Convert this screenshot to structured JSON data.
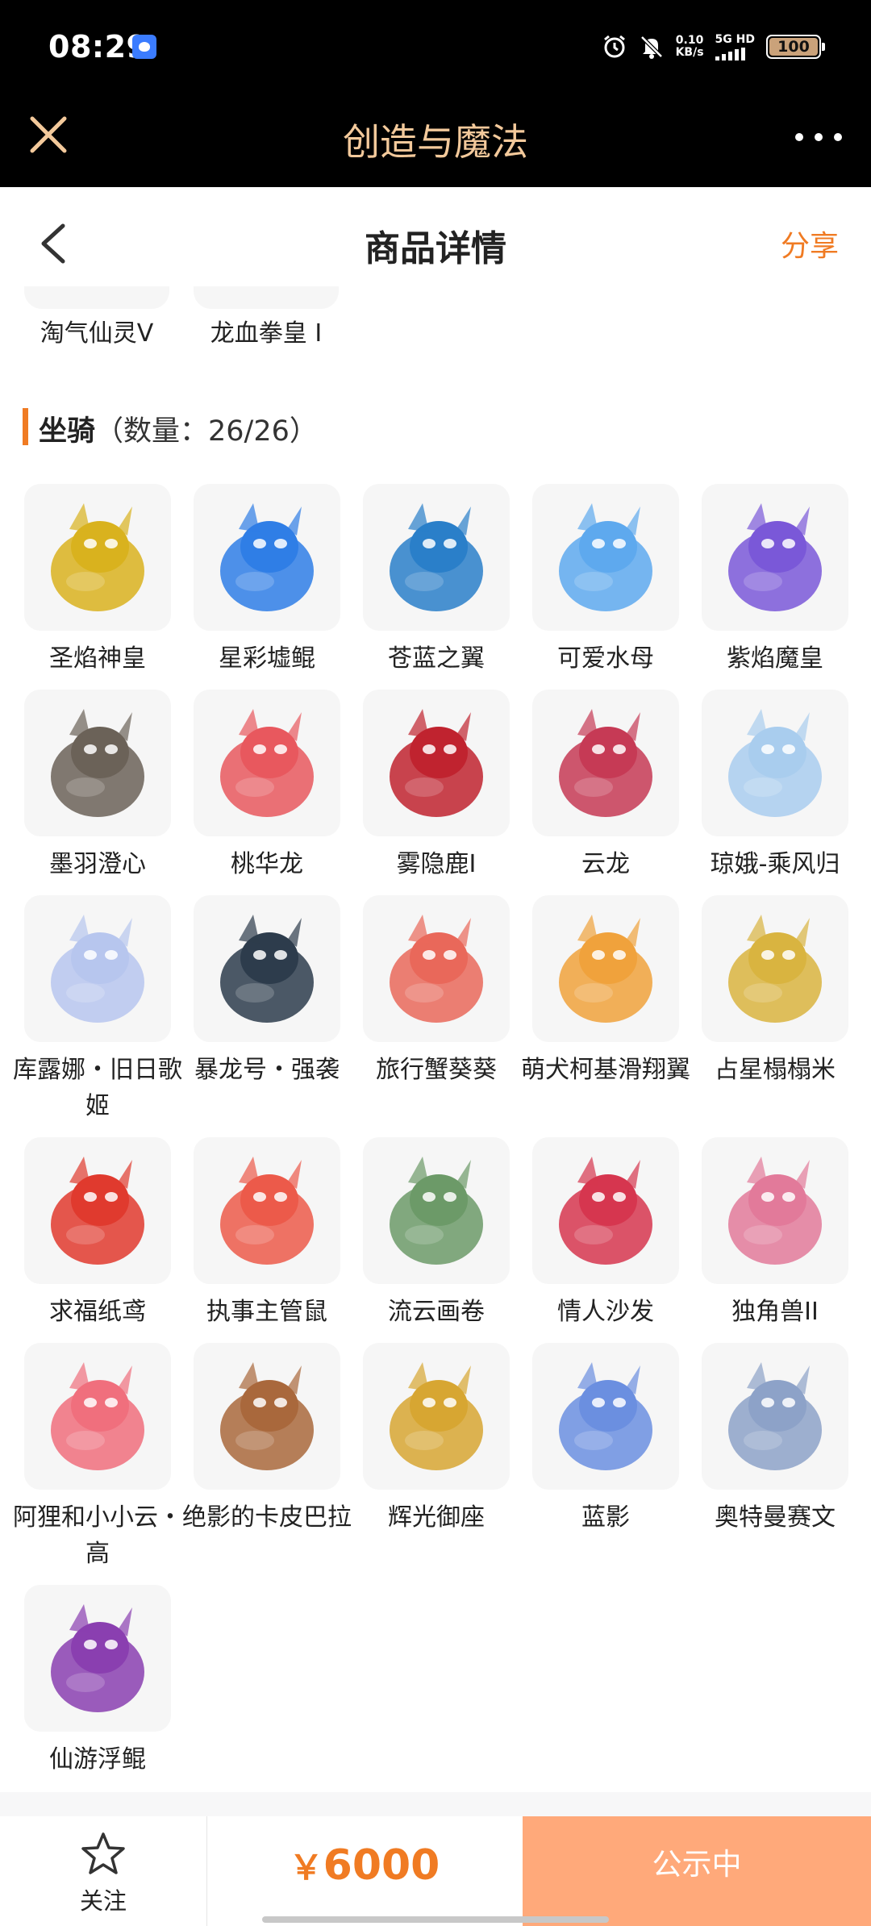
{
  "status_bar": {
    "time": "08:29",
    "net_speed_value": "0.10",
    "net_speed_unit": "KB/s",
    "network": "5G HD",
    "battery": "100",
    "icons": [
      "baidu-app-icon",
      "alarm-icon",
      "mute-bell-icon",
      "signal-icon",
      "battery-icon"
    ]
  },
  "app_header": {
    "title": "创造与魔法",
    "icons": [
      "close-icon",
      "more-icon"
    ]
  },
  "page_header": {
    "title": "商品详情",
    "share": "分享",
    "icons": [
      "back-chevron-icon"
    ]
  },
  "prev_section": {
    "items": [
      "淘气仙灵V",
      "龙血拳皇 I"
    ]
  },
  "section": {
    "label": "坐骑",
    "count": "（数量：26/26）"
  },
  "mounts": [
    {
      "name": "圣焰神皇",
      "color": "#d9b21e"
    },
    {
      "name": "星彩墟鲲",
      "color": "#2f7ee6"
    },
    {
      "name": "苍蓝之翼",
      "color": "#2a7fc9"
    },
    {
      "name": "可爱水母",
      "color": "#5ea9ee"
    },
    {
      "name": "紫焰魔皇",
      "color": "#7a58d8"
    },
    {
      "name": "墨羽澄心",
      "color": "#6b6258"
    },
    {
      "name": "桃华龙",
      "color": "#e8585e"
    },
    {
      "name": "雾隐鹿I",
      "color": "#c0232f"
    },
    {
      "name": "云龙",
      "color": "#c63a55"
    },
    {
      "name": "琼娥-乘风归",
      "color": "#a9cdee"
    },
    {
      "name": "库露娜・旧日歌姬",
      "color": "#b7c6ee"
    },
    {
      "name": "暴龙号・强袭",
      "color": "#2d3c4c"
    },
    {
      "name": "旅行蟹葵葵",
      "color": "#e9685a"
    },
    {
      "name": "萌犬柯基滑翔翼",
      "color": "#f0a23c"
    },
    {
      "name": "占星榻榻米",
      "color": "#d9b440"
    },
    {
      "name": "求福纸鸢",
      "color": "#e03a2e"
    },
    {
      "name": "执事主管鼠",
      "color": "#ec5a4a"
    },
    {
      "name": "流云画卷",
      "color": "#6c9a68"
    },
    {
      "name": "情人沙发",
      "color": "#d6364f"
    },
    {
      "name": "独角兽II",
      "color": "#e27a9a"
    },
    {
      "name": "阿狸和小小云・高",
      "color": "#f06f7d"
    },
    {
      "name": "绝影的卡皮巴拉",
      "color": "#a9683c"
    },
    {
      "name": "辉光御座",
      "color": "#d7a632"
    },
    {
      "name": "蓝影",
      "color": "#6b8fe0"
    },
    {
      "name": "奥特曼赛文",
      "color": "#8da2c8"
    },
    {
      "name": "仙游浮鲲",
      "color": "#8a3fb0"
    }
  ],
  "bottom_bar": {
    "follow": "关注",
    "currency": "￥",
    "price": "6000",
    "status": "公示中",
    "accent": "#f07b23",
    "status_bg": "#ffa97a"
  }
}
